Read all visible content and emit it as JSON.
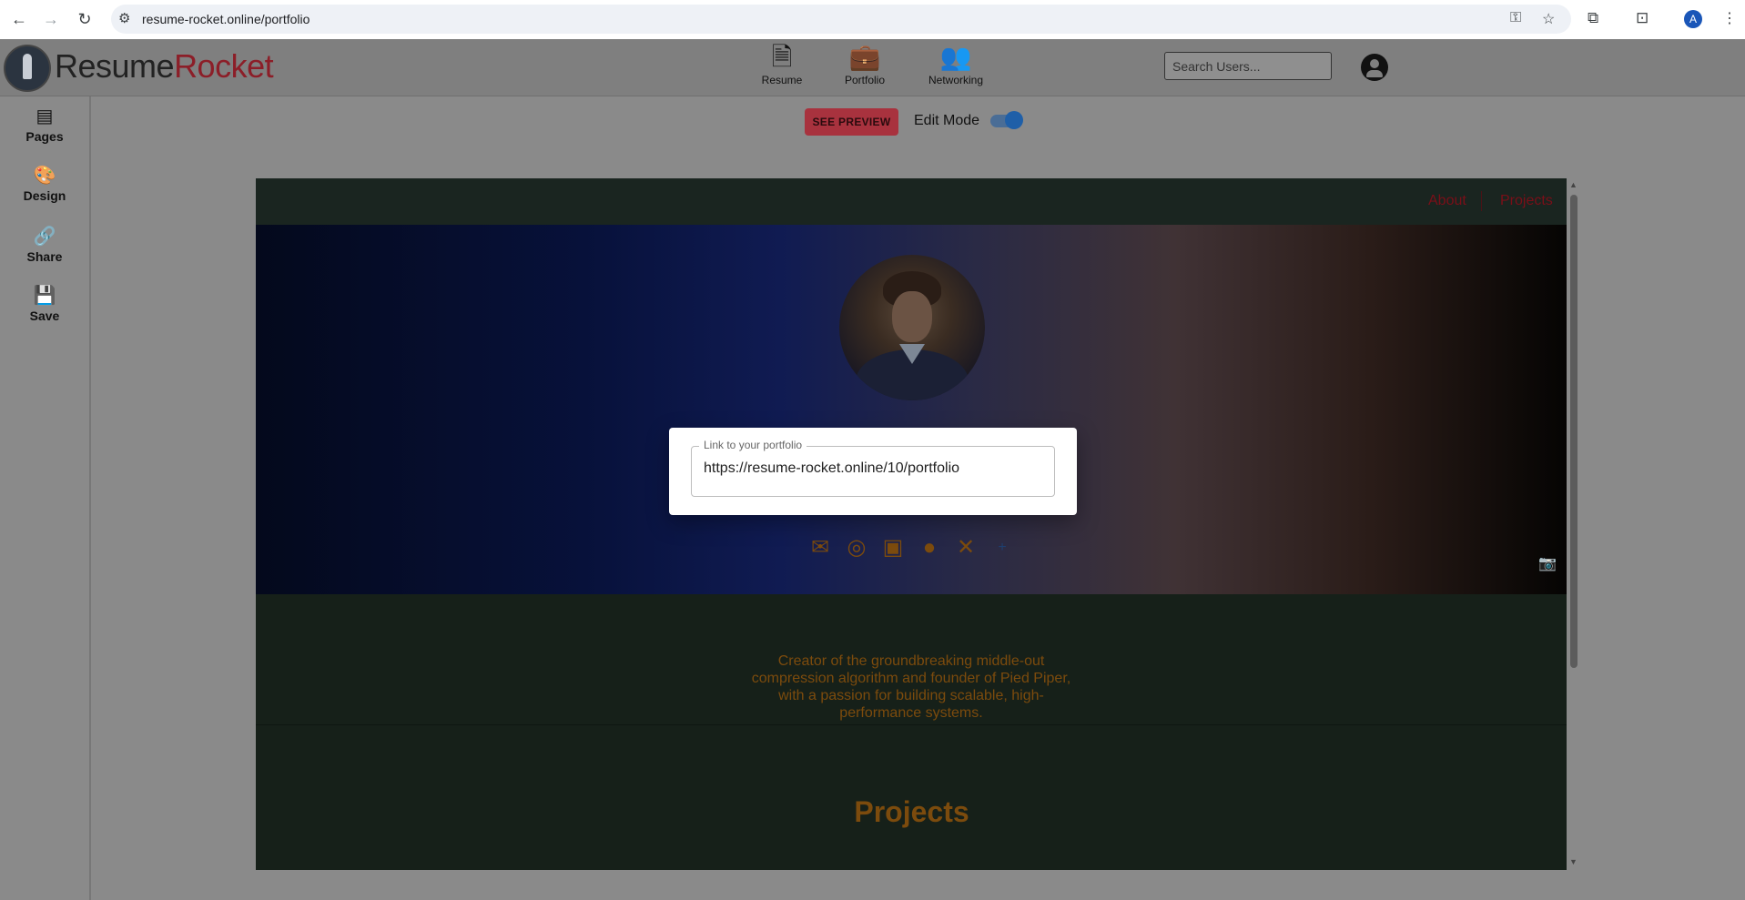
{
  "browser": {
    "url": "resume-rocket.online/portfolio",
    "profile_initial": "A"
  },
  "header": {
    "brand_part1": "Resume",
    "brand_part2": "Rocket",
    "nav": [
      {
        "label": "Resume",
        "icon": "file-icon"
      },
      {
        "label": "Portfolio",
        "icon": "briefcase-icon"
      },
      {
        "label": "Networking",
        "icon": "people-icon"
      }
    ],
    "search_placeholder": "Search Users..."
  },
  "sidebar": {
    "items": [
      {
        "label": "Pages",
        "icon": "pages-icon"
      },
      {
        "label": "Design",
        "icon": "palette-icon"
      },
      {
        "label": "Share",
        "icon": "link-icon"
      },
      {
        "label": "Save",
        "icon": "save-icon"
      }
    ]
  },
  "toolbar": {
    "preview_label": "SEE PREVIEW",
    "edit_mode_label": "Edit Mode",
    "edit_mode_on": true
  },
  "portfolio": {
    "nav_links": [
      "About",
      "Projects"
    ],
    "bio": "Creator of the groundbreaking middle-out compression algorithm and founder of Pied Piper, with a passion for building scalable, high-performance systems.",
    "projects_heading": "Projects",
    "socials": [
      "mail-icon",
      "instagram-icon",
      "linkedin-icon",
      "github-icon",
      "x-icon",
      "add-icon"
    ]
  },
  "share_modal": {
    "field_label": "Link to your portfolio",
    "field_value": "https://resume-rocket.online/10/portfolio"
  },
  "colors": {
    "accent": "#8c1e28",
    "portfolio_text": "#7c4b0d",
    "toggle": "#1f5fa8"
  }
}
